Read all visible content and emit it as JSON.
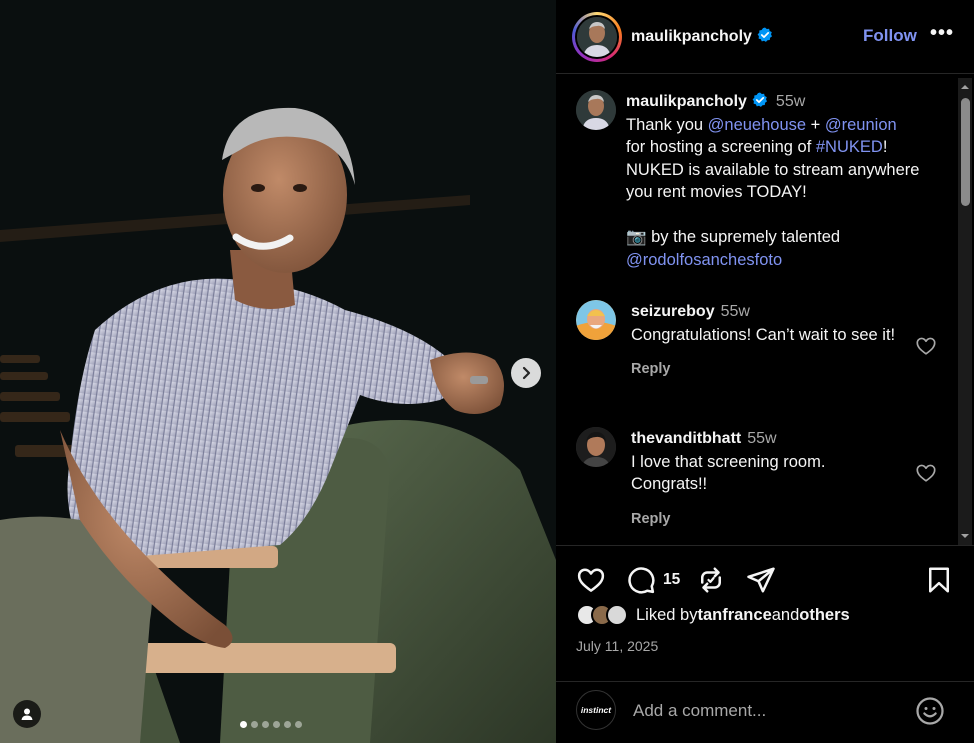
{
  "post": {
    "author": "maulikpancholy",
    "follow_label": "Follow",
    "more_label": "•••",
    "photo_index": 1,
    "photo_count": 6
  },
  "caption": {
    "username": "maulikpancholy",
    "time": "55w",
    "line1_prefix": "Thank you ",
    "mention1": "@neuehouse",
    "plus": " + ",
    "mention2": "@reunion",
    "line2_prefix": "for hosting a screening of ",
    "hashtag": "#NUKED",
    "exclaim": "!",
    "line3": "NUKED is available to stream anywhere you rent movies TODAY!",
    "camera_emoji": "📷",
    "credit_text": " by the supremely talented",
    "credit_mention": "@rodolfosanchesfoto"
  },
  "comments": [
    {
      "username": "seizureboy",
      "time": "55w",
      "text": "Congratulations! Can’t wait to see it!",
      "reply_label": "Reply"
    },
    {
      "username": "thevanditbhatt",
      "time": "55w",
      "text": "I love that screening room. Congrats!!",
      "reply_label": "Reply"
    }
  ],
  "actions": {
    "comment_count": "15",
    "liked_by_prefix": "Liked by ",
    "liked_by_user": "tanfrance",
    "liked_by_and": " and ",
    "liked_by_others": "others",
    "date": "July 11, 2025"
  },
  "composer": {
    "placeholder": "Add a comment...",
    "avatar_text": "instinct"
  },
  "colors": {
    "accent": "#8093f1",
    "verified": "#0095f6",
    "muted": "#a8a8a8"
  },
  "icons": [
    "chevron-right-icon",
    "user-tag-icon",
    "verified-icon",
    "more-icon",
    "heart-icon",
    "comment-icon",
    "repost-icon",
    "share-icon",
    "bookmark-icon",
    "emoji-icon"
  ]
}
